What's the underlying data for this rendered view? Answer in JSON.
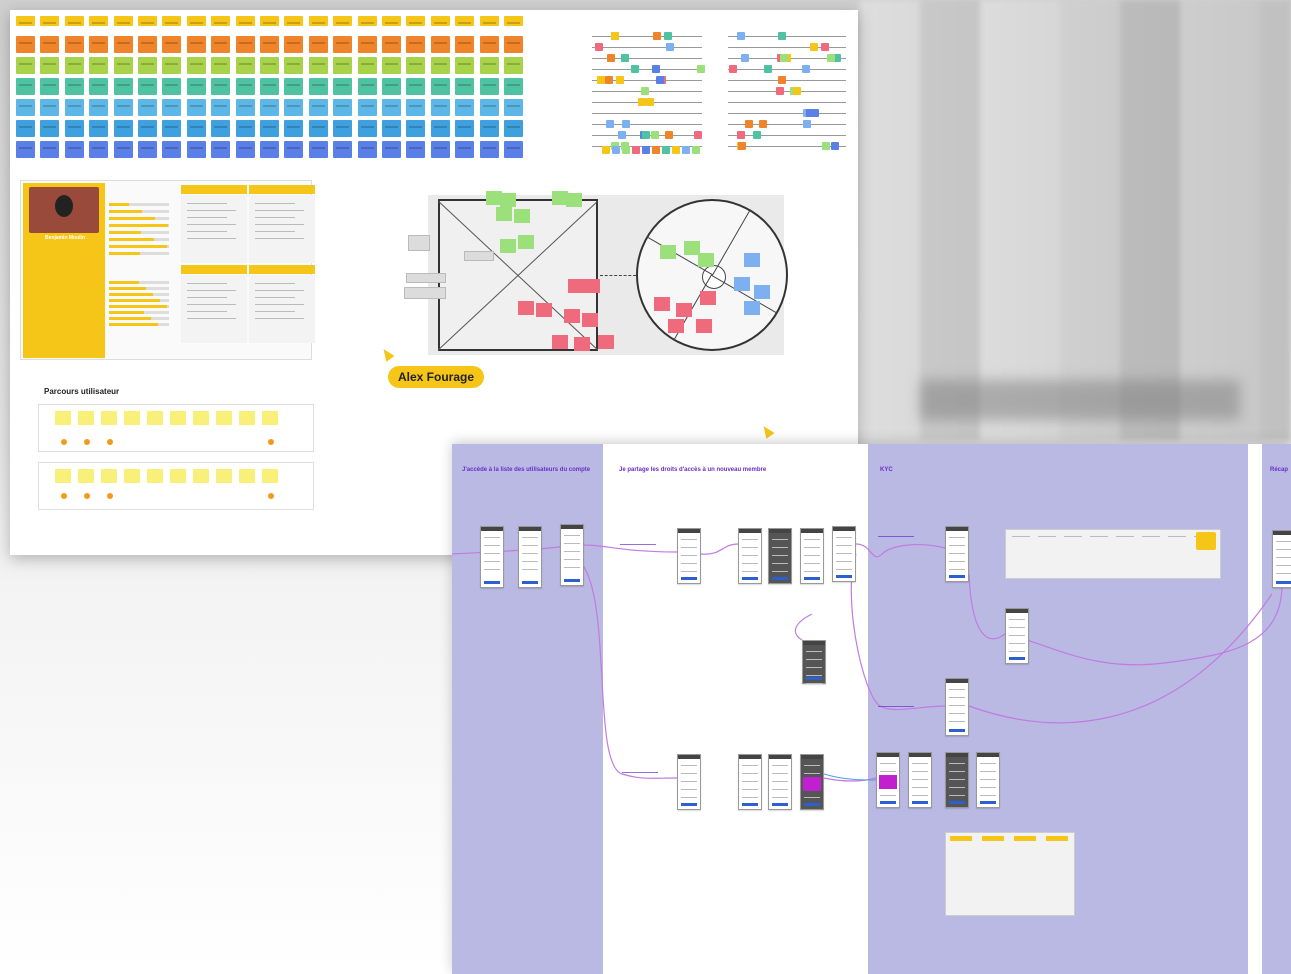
{
  "board1": {
    "persona_name": "Benjamin Moulin",
    "journey_title": "Parcours utilisateur",
    "cursor_label": "Alex Fourage",
    "sticky_colors": [
      "#f5c518",
      "#f0842a",
      "#a8d24a",
      "#4fc3a1",
      "#5db7e6",
      "#3fa0e0",
      "#5a7fe6"
    ],
    "note_colors": {
      "green": "#9be07a",
      "red": "#f06a7e",
      "blue": "#7cb0f0",
      "yellow": "#f9f07a"
    }
  },
  "board2": {
    "lanes": [
      {
        "title": "J'accède à la liste des utilisateurs du compte"
      },
      {
        "title": "Je partage les droits d'accès à un nouveau membre"
      },
      {
        "title": "KYC"
      },
      {
        "title": "Récap"
      }
    ],
    "lane_color": "#b9b9e3",
    "title_color": "#6a2fc9",
    "connector_color": "#c27be0"
  }
}
